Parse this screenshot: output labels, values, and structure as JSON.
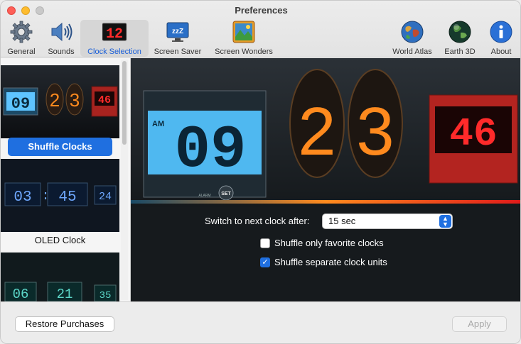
{
  "window": {
    "title": "Preferences"
  },
  "toolbar": {
    "items": [
      {
        "label": "General",
        "icon": "gear-icon"
      },
      {
        "label": "Sounds",
        "icon": "speaker-icon"
      },
      {
        "label": "Clock Selection",
        "icon": "digital-clock-icon"
      },
      {
        "label": "Screen Saver",
        "icon": "monitor-sleep-icon"
      },
      {
        "label": "Screen Wonders",
        "icon": "landscape-icon"
      },
      {
        "label": "World Atlas",
        "icon": "globe-icon"
      },
      {
        "label": "Earth 3D",
        "icon": "earth-icon"
      },
      {
        "label": "About",
        "icon": "info-icon"
      }
    ],
    "clock_icon_digits": "12",
    "screensaver_icon_text": "zzZ"
  },
  "sidebar": {
    "items": [
      {
        "label": "Shuffle Clocks",
        "selected": true,
        "digits": [
          "09",
          "2",
          "3",
          "46"
        ]
      },
      {
        "label": "OLED Clock",
        "selected": false,
        "digits": [
          "03",
          "45",
          "24"
        ]
      },
      {
        "label": "",
        "selected": false,
        "digits": [
          "06",
          "21",
          "35"
        ]
      }
    ]
  },
  "preview": {
    "am_label": "AM",
    "hour": "09",
    "minute_tens": "2",
    "minute_ones": "3",
    "seconds": "46",
    "set_label": "SET",
    "alarm_label": "ALARM"
  },
  "settings": {
    "switch_label": "Switch to next clock after:",
    "switch_value": "15 sec",
    "shuffle_favorites_label": "Shuffle only favorite clocks",
    "shuffle_favorites_checked": false,
    "shuffle_units_label": "Shuffle separate clock units",
    "shuffle_units_checked": true
  },
  "footer": {
    "restore_label": "Restore Purchases",
    "apply_label": "Apply"
  },
  "colors": {
    "accent": "#1f6fe0",
    "lcd_blue": "#4fb8f0",
    "nixie_orange": "#ff8a1e",
    "led_red": "#ff2a2a"
  }
}
